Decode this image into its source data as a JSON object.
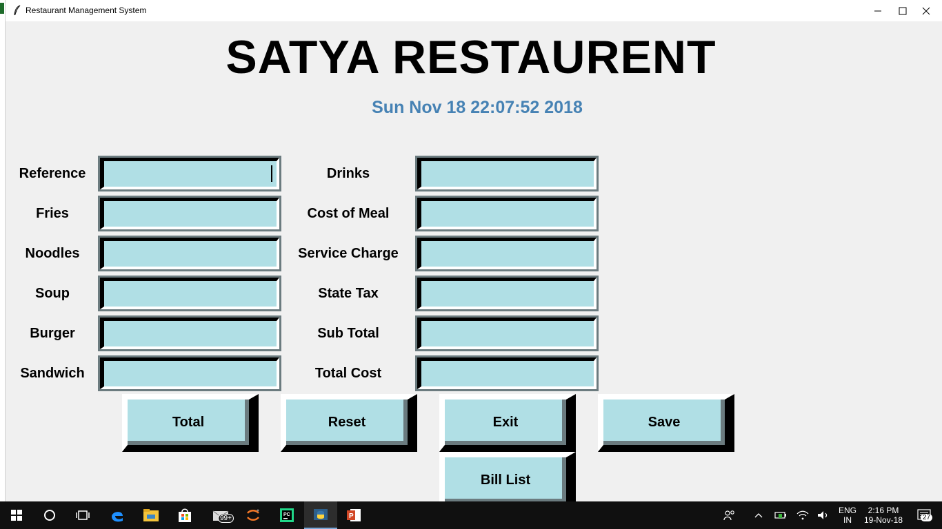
{
  "window": {
    "title": "Restaurant Management System"
  },
  "header": {
    "title": "SATYA RESTAURENT",
    "datetime": "Sun Nov 18 22:07:52 2018"
  },
  "form": {
    "left_labels": [
      "Reference",
      "Fries",
      "Noodles",
      "Soup",
      "Burger",
      "Sandwich"
    ],
    "right_labels": [
      "Drinks",
      "Cost of Meal",
      "Service Charge",
      "State Tax",
      "Sub Total",
      "Total Cost"
    ],
    "left_values": [
      "",
      "",
      "",
      "",
      "",
      ""
    ],
    "right_values": [
      "",
      "",
      "",
      "",
      "",
      ""
    ]
  },
  "buttons": {
    "total": "Total",
    "reset": "Reset",
    "exit": "Exit",
    "save": "Save",
    "bill_list": "Bill List"
  },
  "colors": {
    "field_bg": "#b0dfe5",
    "datetime": "#4682b4",
    "window_bg": "#f0f0f0"
  },
  "taskbar": {
    "apps": [
      "start-icon",
      "cortana-icon",
      "task-view-icon",
      "edge-icon",
      "file-explorer-icon",
      "store-icon",
      "mail-icon",
      "jupyter-icon",
      "pycharm-icon",
      "python-icon",
      "powerpoint-icon"
    ],
    "mail_badge": "99+",
    "language_top": "ENG",
    "language_bottom": "IN",
    "time": "2:16 PM",
    "date": "19-Nov-18",
    "notifications": "27"
  }
}
